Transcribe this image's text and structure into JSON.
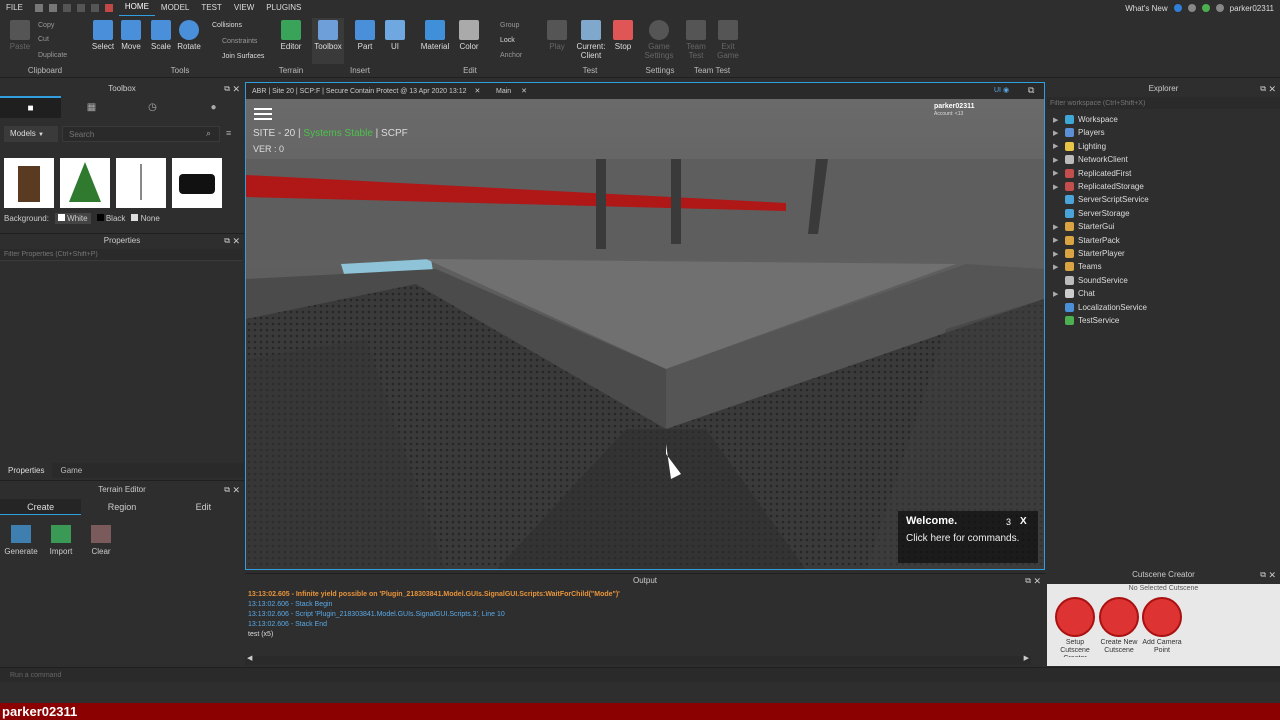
{
  "menubar": {
    "file": "FILE",
    "tabs": [
      "HOME",
      "MODEL",
      "TEST",
      "VIEW",
      "PLUGINS"
    ],
    "active_tab": "HOME",
    "whats_new": "What's New",
    "username": "parker02311"
  },
  "ribbon": {
    "clipboard": {
      "paste": "Paste",
      "copy": "Copy",
      "cut": "Cut",
      "duplicate": "Duplicate",
      "group": "Clipboard"
    },
    "tools": {
      "select": "Select",
      "move": "Move",
      "scale": "Scale",
      "rotate": "Rotate",
      "collisions": "Collisions",
      "constraints": "Constraints",
      "join": "Join Surfaces",
      "group": "Tools"
    },
    "terrain": {
      "editor": "Editor",
      "group": "Terrain"
    },
    "insert": {
      "toolbox": "Toolbox",
      "part": "Part",
      "ui": "UI",
      "group": "Insert"
    },
    "edit": {
      "material": "Material",
      "color": "Color",
      "group_btn": "Group",
      "lock": "Lock",
      "anchor": "Anchor",
      "group": "Edit"
    },
    "test": {
      "play": "Play",
      "current_client": "Current: Client",
      "stop": "Stop",
      "group": "Test"
    },
    "settings": {
      "game_settings": "Game Settings",
      "group": "Settings"
    },
    "team_test": {
      "team_test": "Team Test",
      "exit_game": "Exit Game",
      "group": "Team Test"
    }
  },
  "toolbox": {
    "title": "Toolbox",
    "category": "Models",
    "search_placeholder": "Search",
    "background_label": "Background:",
    "bg_options": [
      "White",
      "Black",
      "None"
    ]
  },
  "properties": {
    "title": "Properties",
    "filter_placeholder": "Filter Properties (Ctrl+Shift+P)",
    "tabs": [
      "Properties",
      "Game"
    ]
  },
  "terrain": {
    "title": "Terrain Editor",
    "tabs": [
      "Create",
      "Region",
      "Edit"
    ],
    "tools": [
      "Generate",
      "Import",
      "Clear"
    ]
  },
  "viewport": {
    "tab_place": "ABR | Site 20 | SCP:F | Secure Contain Protect @ 13 Apr 2020 13:12",
    "tab_main": "Main",
    "ui_toggle": "UI",
    "site": "SITE - 20 |",
    "status": "Systems Stable",
    "org": "| SCPF",
    "version": "VER : 0",
    "player_name": "parker02311",
    "account": "Account: <13",
    "welcome_title": "Welcome.",
    "welcome_count": "3",
    "welcome_close": "X",
    "welcome_body": "Click here for commands."
  },
  "output": {
    "title": "Output",
    "lines": [
      {
        "text": "13:13:02.605 - Infinite yield possible on 'Plugin_218303841.Model.GUIs.SignalGUI.Scripts:WaitForChild(\"Mode\")'",
        "color": "#e8943a"
      },
      {
        "text": "13:13:02.606 - Stack Begin",
        "color": "#5aa9e6"
      },
      {
        "text": "13:13:02.606 - Script 'Plugin_218303841.Model.GUIs.SignalGUI.Scripts.3', Line 10",
        "color": "#5aa9e6"
      },
      {
        "text": "13:13:02.606 - Stack End",
        "color": "#5aa9e6"
      },
      {
        "text": "test (x5)",
        "color": "#dddddd"
      }
    ]
  },
  "explorer": {
    "title": "Explorer",
    "filter_placeholder": "Filter workspace (Ctrl+Shift+X)",
    "items": [
      {
        "label": "Workspace",
        "color": "#3fa7d6",
        "expand": true
      },
      {
        "label": "Players",
        "color": "#5b8fd6",
        "expand": true
      },
      {
        "label": "Lighting",
        "color": "#e8c547",
        "expand": true
      },
      {
        "label": "NetworkClient",
        "color": "#bbbbbb",
        "expand": true
      },
      {
        "label": "ReplicatedFirst",
        "color": "#c44e4e",
        "expand": true
      },
      {
        "label": "ReplicatedStorage",
        "color": "#c44e4e",
        "expand": true
      },
      {
        "label": "ServerScriptService",
        "color": "#4aa3d9",
        "expand": false
      },
      {
        "label": "ServerStorage",
        "color": "#4aa3d9",
        "expand": false
      },
      {
        "label": "StarterGui",
        "color": "#d9a441",
        "expand": true
      },
      {
        "label": "StarterPack",
        "color": "#d9a441",
        "expand": true
      },
      {
        "label": "StarterPlayer",
        "color": "#d9a441",
        "expand": true
      },
      {
        "label": "Teams",
        "color": "#d9a441",
        "expand": true
      },
      {
        "label": "SoundService",
        "color": "#bbbbbb",
        "expand": false
      },
      {
        "label": "Chat",
        "color": "#cccccc",
        "expand": true
      },
      {
        "label": "LocalizationService",
        "color": "#4a90d9",
        "expand": false
      },
      {
        "label": "TestService",
        "color": "#4caf50",
        "expand": false
      }
    ]
  },
  "cutscene": {
    "title": "Cutscene Creator",
    "subtitle": "No Selected Cutscene",
    "buttons": [
      "Setup Cutscene Creator",
      "Create New Cutscene",
      "Add Camera Point"
    ]
  },
  "command_bar": {
    "placeholder": "Run a command"
  },
  "bottom_label": "parker02311"
}
